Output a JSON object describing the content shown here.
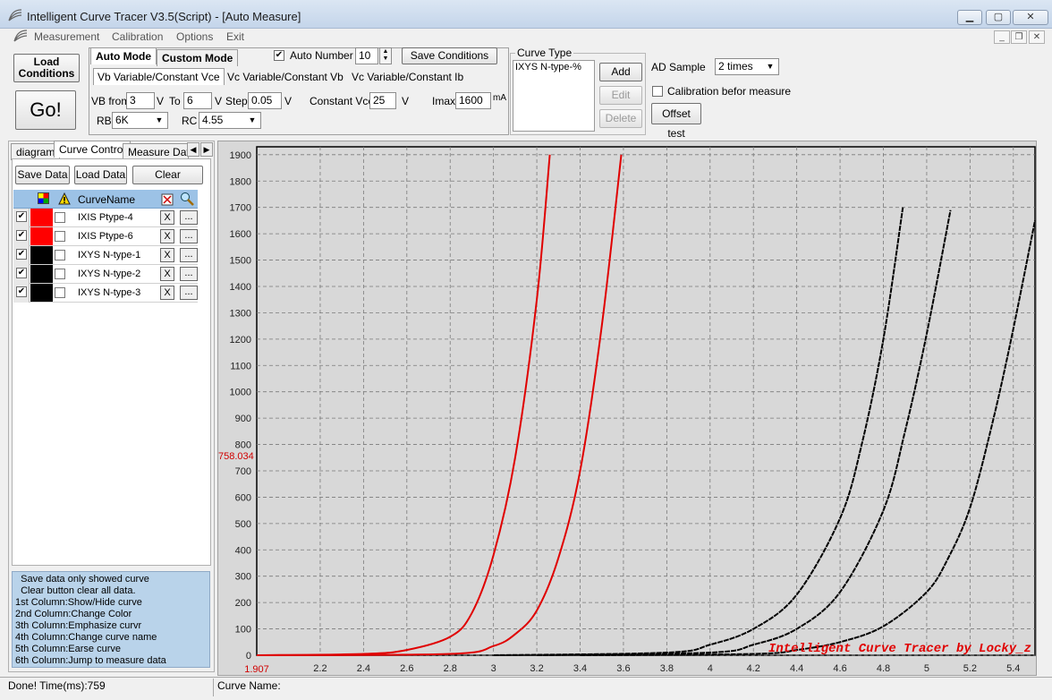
{
  "window": {
    "title": "Intelligent Curve Tracer V3.5(Script) - [Auto Measure]"
  },
  "menu": [
    "Measurement",
    "Calibration",
    "Options",
    "Exit"
  ],
  "toolbar": {
    "load_conditions": [
      "Load",
      "Conditions"
    ],
    "go": "Go!",
    "mode_tabs": [
      "Auto Mode",
      "Custom Mode"
    ],
    "auto_number_label": "Auto Number",
    "auto_number_checked": true,
    "auto_number_value": "10",
    "save_conditions": "Save Conditions",
    "sub_tabs": [
      "Vb Variable/Constant Vce",
      "Vc Variable/Constant Vb",
      "Vc Variable/Constant Ib"
    ],
    "vb_from_label": "VB from",
    "vb_from": "3",
    "v_unit": "V",
    "to_label": "To",
    "to_value": "6",
    "step_label": "Step",
    "step_value": "0.05",
    "constant_vce_label": "Constant Vce",
    "constant_vce": "25",
    "imax_label": "Imax",
    "imax": "1600",
    "ma_unit": "mA",
    "rb_label": "RB",
    "rb_value": "6K",
    "rc_label": "RC",
    "rc_value": "4.55"
  },
  "curve_type": {
    "group_label": "Curve Type",
    "items": [
      "IXYS N-type-%"
    ],
    "add": "Add",
    "edit": "Edit",
    "delete": "Delete"
  },
  "ad_sample": {
    "label": "AD Sample",
    "value": "2 times",
    "calibration_label": "Calibration befor measure",
    "calibration_checked": false,
    "offset_test": "Offset test"
  },
  "left_tabs": [
    "diagram",
    "Curve Control",
    "Measure Data"
  ],
  "curve_control": {
    "save_data": "Save Data",
    "load_data": "Load Data",
    "clear": "Clear",
    "header_name": "CurveName",
    "curves": [
      {
        "name": "IXIS Ptype-4",
        "color": "#ff0000",
        "shown": true
      },
      {
        "name": "IXIS Ptype-6",
        "color": "#ff0000",
        "shown": true
      },
      {
        "name": "IXYS N-type-1",
        "color": "#000000",
        "shown": true
      },
      {
        "name": "IXYS N-type-2",
        "color": "#000000",
        "shown": true
      },
      {
        "name": "IXYS N-type-3",
        "color": "#000000",
        "shown": true
      }
    ],
    "x_label": "X",
    "dots_label": "..."
  },
  "help_lines": [
    "  Save data only showed curve",
    "  Clear button clear all data.",
    "1st Column:Show/Hide curve",
    "2nd Column:Change Color",
    "3th Column:Emphasize curvr",
    "4th Column:Change curve name",
    "5th Column:Earse curve",
    "6th Column:Jump to measure data"
  ],
  "chart_data": {
    "type": "line",
    "xlim": [
      1.907,
      5.5
    ],
    "ylim": [
      0,
      1930
    ],
    "x_ticks": [
      2.2,
      2.4,
      2.6,
      2.8,
      3,
      3.2,
      3.4,
      3.6,
      3.8,
      4,
      4.2,
      4.4,
      4.6,
      4.8,
      5,
      5.2,
      5.4
    ],
    "y_ticks": [
      0,
      100,
      200,
      300,
      400,
      500,
      600,
      700,
      800,
      900,
      1000,
      1100,
      1200,
      1300,
      1400,
      1500,
      1600,
      1700,
      1800,
      1900
    ],
    "x_origin_label": "1.907",
    "y_marker_label": "758.034",
    "y_marker_value": 758.034,
    "watermark": "Intelligent Curve Tracer by Locky_z",
    "grid": true,
    "series": [
      {
        "name": "IXIS Ptype-4",
        "color": "#e00000",
        "x": [
          1.907,
          2.4,
          2.6,
          2.8,
          2.9,
          3.0,
          3.1,
          3.2,
          3.26
        ],
        "y": [
          0,
          5,
          20,
          70,
          160,
          380,
          750,
          1350,
          1900
        ]
      },
      {
        "name": "IXIS Ptype-6",
        "color": "#e00000",
        "x": [
          1.907,
          2.8,
          3.0,
          3.1,
          3.2,
          3.3,
          3.4,
          3.5,
          3.59
        ],
        "y": [
          0,
          5,
          35,
          80,
          170,
          370,
          700,
          1250,
          1900
        ]
      },
      {
        "name": "IXYS N-type-1",
        "color": "#000000",
        "x": [
          3.0,
          3.8,
          4.0,
          4.2,
          4.4,
          4.6,
          4.7,
          4.8,
          4.89
        ],
        "y": [
          0,
          10,
          40,
          100,
          230,
          520,
          800,
          1200,
          1700
        ]
      },
      {
        "name": "IXYS N-type-2",
        "color": "#000000",
        "x": [
          3.2,
          4.0,
          4.2,
          4.4,
          4.6,
          4.8,
          4.9,
          5.0,
          5.11
        ],
        "y": [
          0,
          10,
          40,
          100,
          240,
          550,
          850,
          1220,
          1690
        ]
      },
      {
        "name": "IXYS N-type-3",
        "color": "#000000",
        "x": [
          3.4,
          4.2,
          4.4,
          4.6,
          4.8,
          5.0,
          5.1,
          5.2,
          5.3,
          5.39,
          5.5
        ],
        "y": [
          0,
          5,
          20,
          50,
          110,
          240,
          370,
          560,
          870,
          1200,
          1650
        ]
      }
    ]
  },
  "status": {
    "left": "Done!  Time(ms):759",
    "curve_name_label": "Curve Name:"
  }
}
